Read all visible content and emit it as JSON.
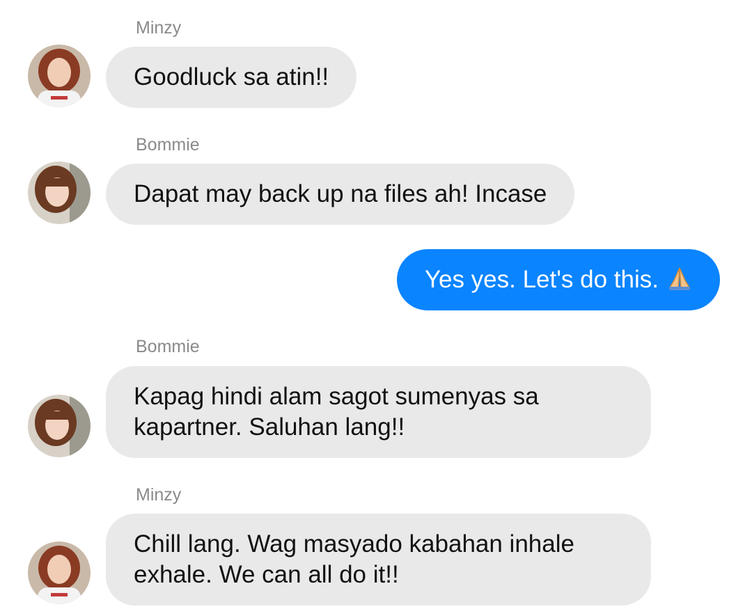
{
  "messages": [
    {
      "sender": "Minzy",
      "text": "Goodluck sa atin!!",
      "direction": "incoming"
    },
    {
      "sender": "Bommie",
      "text": "Dapat may back up na files ah! Incase",
      "direction": "incoming"
    },
    {
      "sender": "",
      "text": "Yes yes. Let's do this.",
      "emoji": "folded-hands-emoji",
      "direction": "outgoing"
    },
    {
      "sender": "Bommie",
      "line1": "Kapag hindi alam sagot sumenyas sa",
      "line2": "kapartner. Saluhan lang!!",
      "direction": "incoming"
    },
    {
      "sender": "Minzy",
      "line1": "Chill lang. Wag masyado kabahan inhale",
      "line2": "exhale. We can all do it!!",
      "direction": "incoming"
    }
  ],
  "colors": {
    "incoming_bubble": "#e9e9e9",
    "outgoing_bubble": "#0a84ff",
    "sender_name": "#8a8a8a",
    "text_dark": "#111111"
  }
}
